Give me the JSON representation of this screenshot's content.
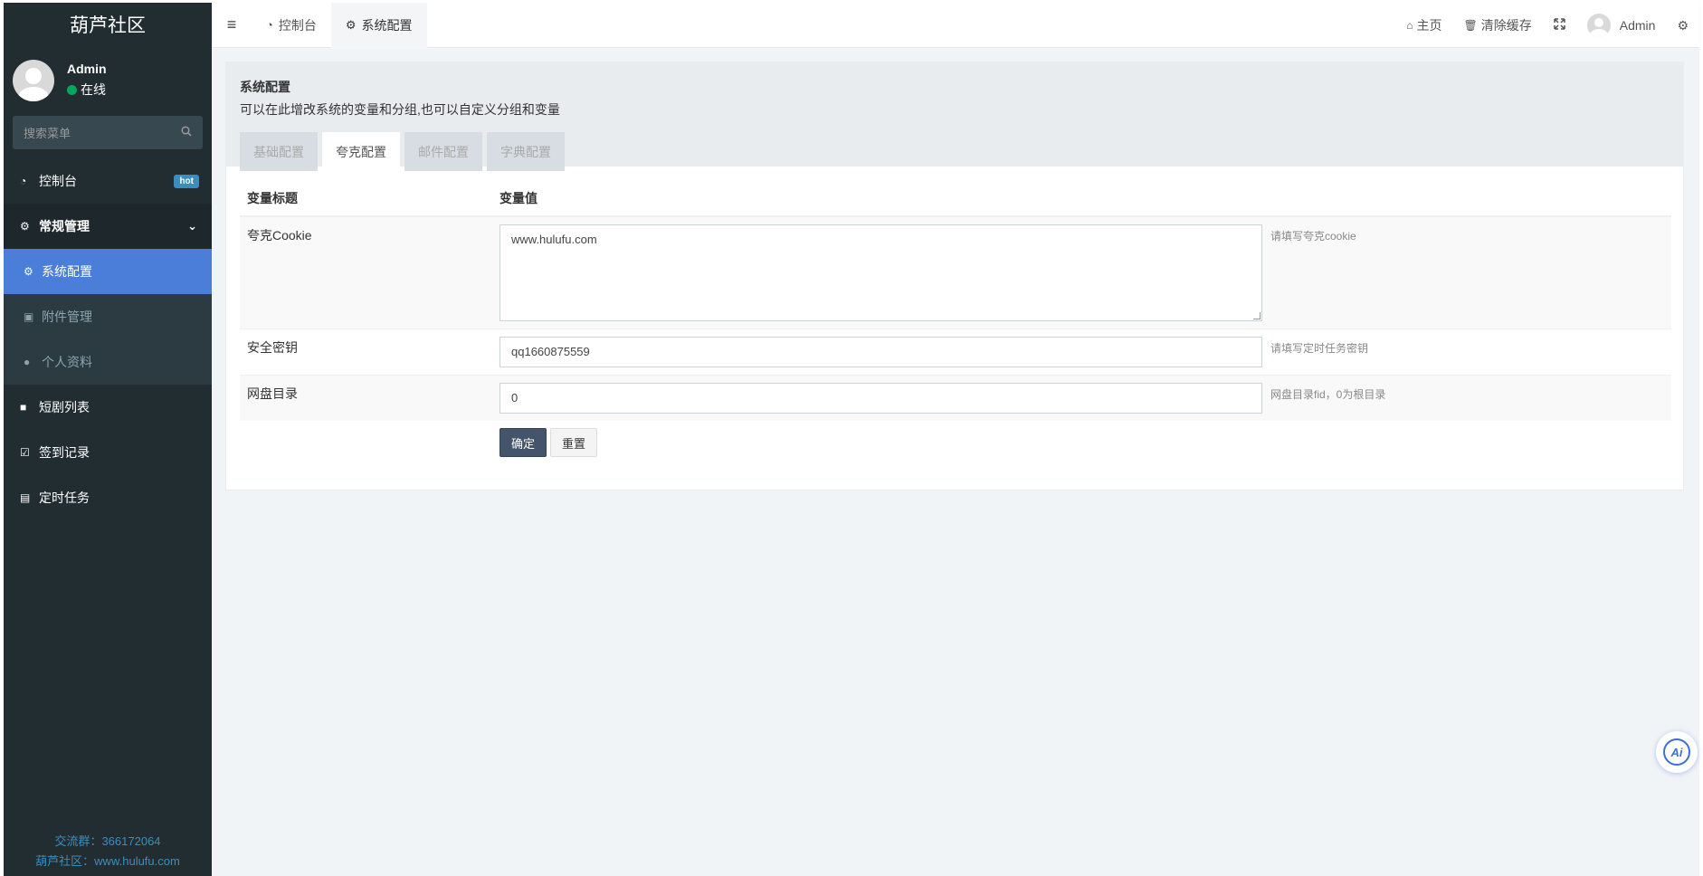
{
  "app": {
    "title": "葫芦社区"
  },
  "user": {
    "name": "Admin",
    "status": "在线"
  },
  "sidebar": {
    "search_placeholder": "搜索菜单",
    "items": [
      {
        "label": "控制台",
        "icon": "dashboard-icon",
        "badge": "hot"
      },
      {
        "label": "常规管理",
        "icon": "cogs-icon"
      },
      {
        "label": "短剧列表",
        "icon": "video-icon"
      },
      {
        "label": "签到记录",
        "icon": "calendar-check-icon"
      },
      {
        "label": "定时任务",
        "icon": "file-chart-icon"
      }
    ],
    "subitems": [
      {
        "label": "系统配置",
        "icon": "gear-icon"
      },
      {
        "label": "附件管理",
        "icon": "image-file-icon"
      },
      {
        "label": "个人资料",
        "icon": "user-icon"
      }
    ],
    "footer": {
      "group": "交流群：366172064",
      "site": "葫芦社区：www.hulufu.com"
    }
  },
  "topbar": {
    "tabs": [
      {
        "label": "控制台",
        "icon": "dashboard-icon"
      },
      {
        "label": "系统配置",
        "icon": "gear-icon"
      }
    ],
    "home": "主页",
    "clear_cache": "清除缓存",
    "user": "Admin"
  },
  "panel": {
    "title": "系统配置",
    "description": "可以在此增改系统的变量和分组,也可以自定义分组和变量",
    "tabs": [
      "基础配置",
      "夸克配置",
      "邮件配置",
      "字典配置"
    ],
    "active_tab": "夸克配置",
    "table": {
      "headers": [
        "变量标题",
        "变量值"
      ],
      "rows": [
        {
          "label": "夸克Cookie",
          "value": "www.hulufu.com",
          "hint": "请填写夸克cookie"
        },
        {
          "label": "安全密钥",
          "value": "qq1660875559",
          "hint": "请填写定时任务密钥"
        },
        {
          "label": "网盘目录",
          "value": "0",
          "hint": "网盘目录fid，0为根目录"
        }
      ]
    },
    "buttons": {
      "confirm": "确定",
      "reset": "重置"
    }
  },
  "floating": {
    "ai_label": "Ai"
  },
  "colors": {
    "sidebar_bg": "#222d32",
    "active_item": "#4a7ed9",
    "primary_button": "#44546a",
    "footer_link": "#3c8dbc"
  }
}
